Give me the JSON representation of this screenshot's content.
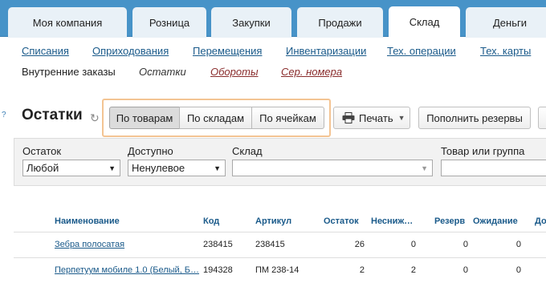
{
  "tabs": [
    {
      "label": "Моя компания"
    },
    {
      "label": "Розница"
    },
    {
      "label": "Закупки"
    },
    {
      "label": "Продажи"
    },
    {
      "label": "Склад"
    },
    {
      "label": "Деньги"
    }
  ],
  "active_tab": "Склад",
  "subnav": {
    "row1": [
      "Списания",
      "Оприходования",
      "Перемещения",
      "Инвентаризации",
      "Тех. операции",
      "Тех. карты"
    ],
    "row2": [
      "Внутренние заказы",
      "Остатки",
      "Обороты",
      "Сер. номера"
    ]
  },
  "page": {
    "help": "?",
    "title": "Остатки",
    "view_modes": [
      "По товарам",
      "По складам",
      "По ячейкам"
    ],
    "active_view": "По товарам",
    "print_label": "Печать",
    "replenish_label": "Пополнить резервы"
  },
  "filters": {
    "balance_label": "Остаток",
    "balance_value": "Любой",
    "available_label": "Доступно",
    "available_value": "Ненулевое",
    "warehouse_label": "Склад",
    "warehouse_value": "",
    "product_label": "Товар или группа",
    "product_value": ""
  },
  "table": {
    "columns": [
      "Наименование",
      "Код",
      "Артикул",
      "Остаток",
      "Несниж…",
      "Резерв",
      "Ожидание",
      "До"
    ],
    "rows": [
      {
        "name": "Зебра полосатая",
        "code": "238415",
        "article": "238415",
        "balance": "26",
        "non_reduce": "0",
        "reserve": "0",
        "expected": "0"
      },
      {
        "name": "Перпетуум мобиле 1.0 (Белый, Б…",
        "code": "194328",
        "article": "ПМ 238-14",
        "balance": "2",
        "non_reduce": "2",
        "reserve": "0",
        "expected": "0"
      }
    ]
  }
}
